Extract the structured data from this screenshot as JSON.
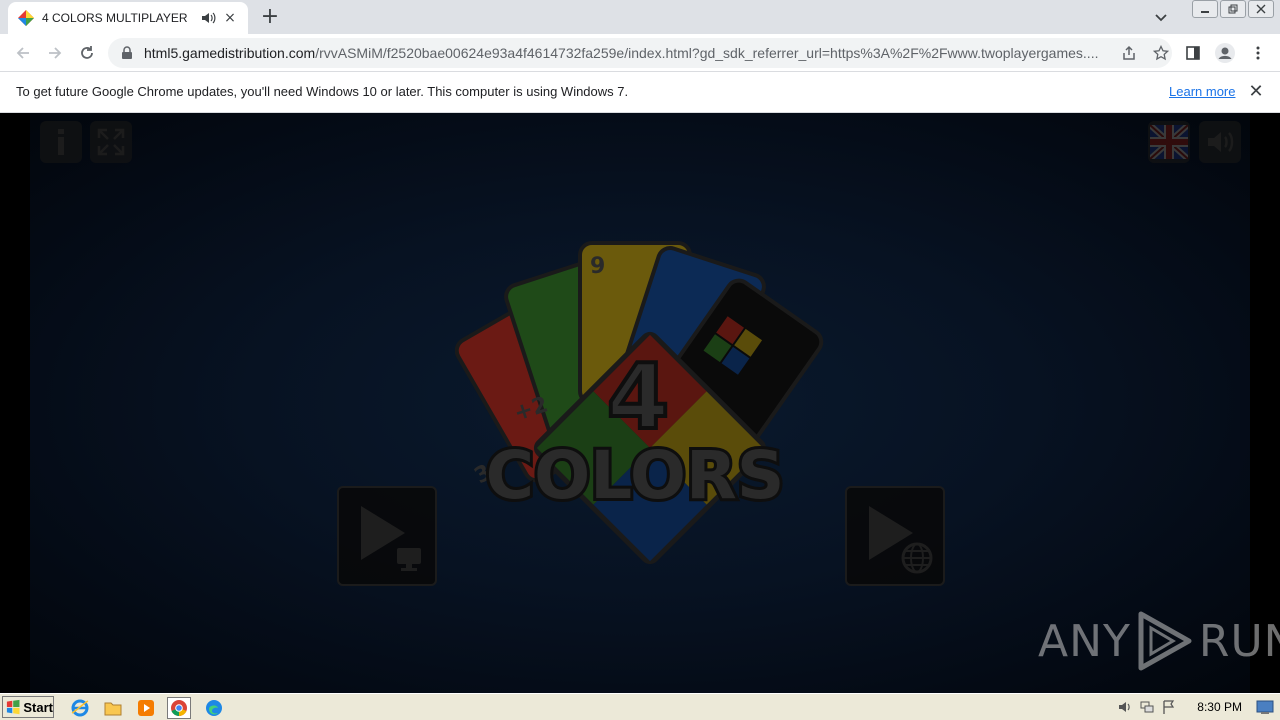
{
  "browser": {
    "tab_title": "4 COLORS MULTIPLAYER",
    "url_host": "html5.gamedistribution.com",
    "url_path": "/rvvASMiM/f2520bae00624e93a4f4614732fa259e/index.html?gd_sdk_referrer_url=https%3A%2F%2Fwww.twoplayergames....",
    "new_tab_label": "+",
    "close_tab_label": "×"
  },
  "infobar": {
    "message": "To get future Google Chrome updates, you'll need Windows 10 or later. This computer is using Windows 7.",
    "link": "Learn more",
    "close": "✕"
  },
  "game": {
    "logo_number": "4",
    "logo_word": "COLORS",
    "card_labels": [
      "3",
      "+2",
      "9"
    ],
    "watermark_left": "ANY",
    "watermark_right": "RUN"
  },
  "taskbar": {
    "start_label": "Start",
    "clock": "8:30 PM"
  },
  "colors": {
    "card_red": "#6b1a14",
    "card_yellow": "#6b5a0c",
    "card_green": "#1f4a18",
    "card_blue": "#0c2a55",
    "card_black": "#0a0a0a"
  }
}
